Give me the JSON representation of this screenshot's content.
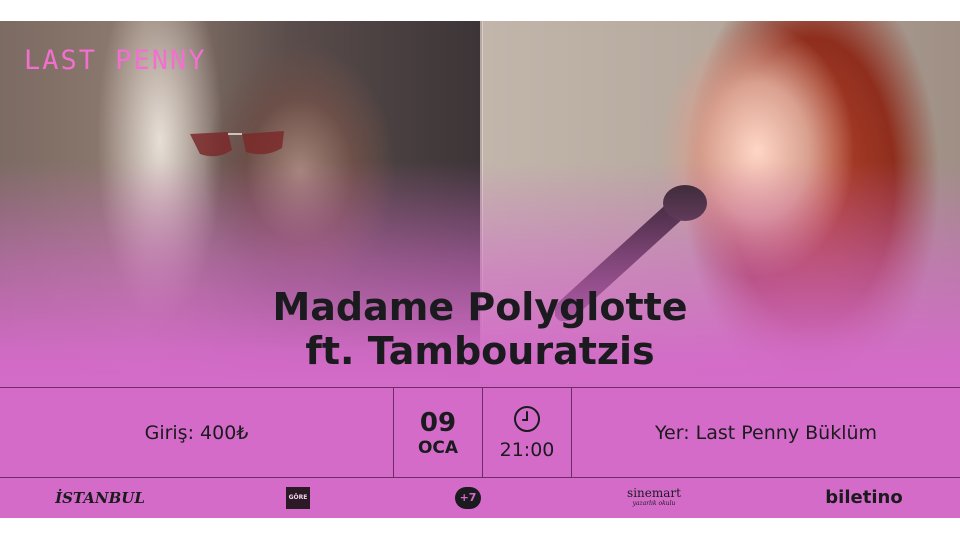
{
  "brand": "LAST PENNY",
  "title": {
    "line1": "Madame Polyglotte",
    "line2": "ft. Tambouratzis"
  },
  "info": {
    "price": "Giriş: 400₺",
    "date_day": "09",
    "date_month": "OCA",
    "time": "21:00",
    "venue": "Yer: Last Penny Büklüm",
    "clock_icon": "clock-icon"
  },
  "logos": {
    "istanbul": "İSTANBUL",
    "gore": "GÖRE",
    "plus7": "+7",
    "sinemart": "sinemart",
    "sinemart_sub": "yazarlık okulu",
    "biletino": "biletino"
  },
  "colors": {
    "background": "#d46bc9",
    "brand": "#f36fcf",
    "text": "#1b1b1f"
  }
}
